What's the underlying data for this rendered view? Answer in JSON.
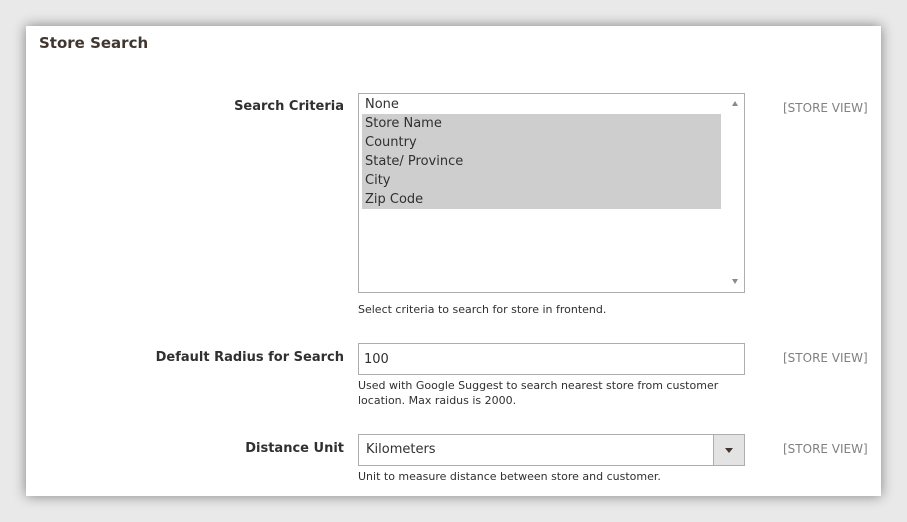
{
  "section": {
    "title": "Store Search"
  },
  "fields": {
    "search_criteria": {
      "label": "Search Criteria",
      "scope": "[STORE VIEW]",
      "options": [
        {
          "label": "None",
          "selected": false
        },
        {
          "label": "Store Name",
          "selected": true
        },
        {
          "label": "Country",
          "selected": true
        },
        {
          "label": "State/ Province",
          "selected": true
        },
        {
          "label": "City",
          "selected": true
        },
        {
          "label": "Zip Code",
          "selected": true
        }
      ],
      "note": "Select criteria to search for store in frontend."
    },
    "default_radius": {
      "label": "Default Radius for Search",
      "scope": "[STORE VIEW]",
      "value": "100",
      "note": "Used with Google Suggest to search nearest store from customer location. Max raidus is 2000."
    },
    "distance_unit": {
      "label": "Distance Unit",
      "scope": "[STORE VIEW]",
      "value": "Kilometers",
      "note": "Unit to measure distance between store and customer."
    }
  },
  "colors": {
    "selected_option_bg": "#cecece",
    "border": "#adadad",
    "scope_text": "#808080"
  }
}
